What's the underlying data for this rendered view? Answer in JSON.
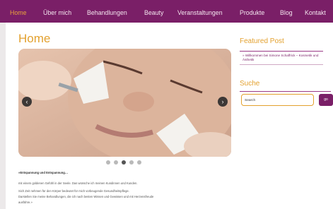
{
  "nav": {
    "items": [
      "Home",
      "Über mich",
      "Behandlungen",
      "Beauty",
      "Veranstaltungen",
      "Produkte",
      "Blog",
      "Kontakt"
    ],
    "active": "Home"
  },
  "main": {
    "title": "Home",
    "intro_heading": "»Entspannung und Entspannung…",
    "paragraphs": [
      "mit einem goldenen Gefühl in der Seele. Das wünsche ich meinen Kundinnen und Kunden.",
      "Sich Zeit nehmen für den Körper bedeutet für mich vorbeugende Gesundheitspflege.",
      "Darstellen Sie meine Behandlungen, die ich nach besten Wissen und Gewissen und mit Herzensfreude",
      "ausführe.»"
    ]
  },
  "slider": {
    "prev_glyph": "‹",
    "next_glyph": "›",
    "dot_count": 5,
    "active_dot": 2
  },
  "sidebar": {
    "featured_title": "Featured Post",
    "featured_link": "» Willkommen bei Simone Schaffrick – Kosmetik und Ästhetik",
    "search_title": "Suche",
    "search_value": "Search",
    "search_button": "go"
  },
  "colors": {
    "nav_bg": "#7a1f67",
    "accent": "#e3a12f"
  }
}
